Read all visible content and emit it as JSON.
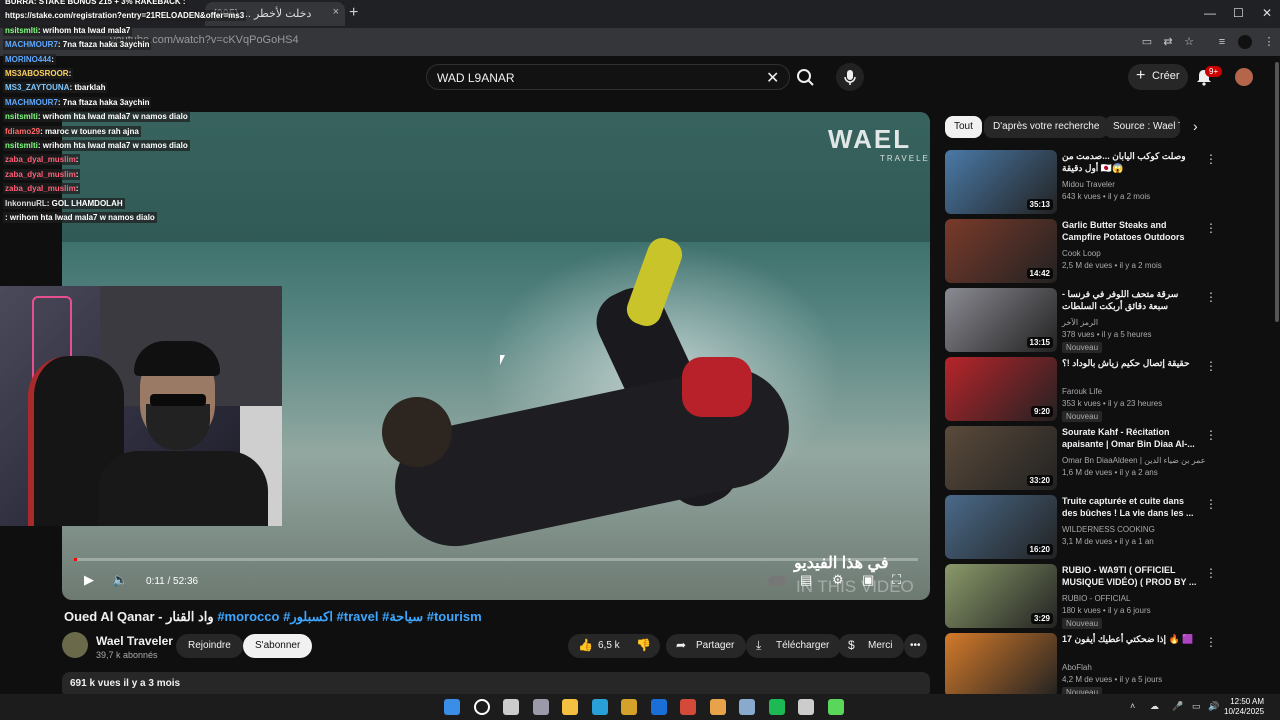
{
  "browser": {
    "tab_title": "دخلت لأخطر ... (295)",
    "tab_close": "×",
    "new_tab": "+",
    "url": "youtube.com/watch?v=cKVqPoGoHS4",
    "minimize": "—",
    "maximize": "☐",
    "close": "✕"
  },
  "youtube": {
    "search_value": "WAD L9ANAR",
    "create_label": "Créer",
    "notif_count": "9+"
  },
  "video": {
    "title_main": "Oued Al Qanar - واد القنار ",
    "title_tags": "#morocco #اكسبلور #travel #سياحة #tourism",
    "time": "0:11 / 52:36",
    "overlay_arabic": "في هذا الفيديو",
    "overlay_in_video": "IN THIS VIDEO",
    "watermark": "WAEL",
    "watermark_sub": "TRAVELER",
    "progress": 0.004
  },
  "channel": {
    "name": "Wael Traveler",
    "subs": "39,7 k abonnés",
    "join_label": "Rejoindre",
    "subscribe_label": "S'abonner"
  },
  "actions": {
    "likes": "6,5 k",
    "share": "Partager",
    "download": "Télécharger",
    "thanks": "Merci",
    "more": "•••"
  },
  "description": {
    "stats": "691 k vues  il y a 3 mois"
  },
  "chips": [
    "Tout",
    "D'après votre recherche",
    "Source : Wael T"
  ],
  "recommendations": [
    {
      "title": "وصلت كوكب اليابان ...صدمت من أول دقيقة 🇯🇵😱",
      "channel": "Midou Traveler",
      "meta": "643 k vues • il y a 2 mois",
      "duration": "35:13",
      "new": "",
      "color": "#4a7aa8"
    },
    {
      "title": "Garlic Butter Steaks and Campfire Potatoes Outdoors",
      "channel": "Cook Loop",
      "meta": "2,5 M de vues • il y a 2 mois",
      "duration": "14:42",
      "new": "",
      "color": "#7a3a2a"
    },
    {
      "title": "سرقة متحف اللوفر في فرنسا - سبعة دقائق أربكت السلطات الفرنسية",
      "channel": "الرمز الآخر",
      "meta": "378 vues • il y a 5 heures",
      "duration": "13:15",
      "new": "Nouveau",
      "color": "#8a8a92"
    },
    {
      "title": "حقيقة إتصال حكيم زياش بالوداد !؟",
      "channel": "Farouk Life",
      "meta": "353 k vues • il y a 23 heures",
      "duration": "9:20",
      "new": "Nouveau",
      "color": "#b8242a"
    },
    {
      "title": "Sourate Kahf - Récitation apaisante | Omar Bin Diaa Al-...",
      "channel": "Omar Bn DiaaAldeen | عمر بن ضياء الدين",
      "meta": "1,6 M de vues • il y a 2 ans",
      "duration": "33:20",
      "new": "",
      "color": "#5a4a3a"
    },
    {
      "title": "Truite capturée et cuite dans des bûches ! La vie dans les ...",
      "channel": "WILDERNESS COOKING",
      "meta": "3,1 M de vues • il y a 1 an",
      "duration": "16:20",
      "new": "",
      "color": "#4a6a8a"
    },
    {
      "title": "RUBIO - WA9TI ( OFFICIEL MUSIQUE VIDÉO) ( PROD BY ...",
      "channel": "RUBIO - OFFICIAL",
      "meta": "180 k vues • il y a 6 jours",
      "duration": "3:29",
      "new": "Nouveau",
      "color": "#8a9a6a"
    },
    {
      "title": "إذا ضحكتي أعطيك أيفون 17 🔥 🟪",
      "channel": "AboFlah",
      "meta": "4,2 M de vues • il y a 5 jours",
      "duration": "",
      "new": "Nouveau",
      "color": "#d47a2a"
    }
  ],
  "chat": [
    {
      "user": "BURRA",
      "msg": ": STAKE BONUS 215 + 3% RAKEBACK :",
      "ucolor": "#ffffff"
    },
    {
      "user": "https://stake.com/registration?entry=21RELOADEN&offer=ms3",
      "msg": "",
      "ucolor": "#ffffff"
    },
    {
      "user": "nsitsmlti",
      "msg": ": wrihom hta lwad mala7",
      "ucolor": "#7fff7f"
    },
    {
      "user": "MACHMOUR7",
      "msg": ": 7na ftaza haka 3aychin",
      "ucolor": "#5fa8ff"
    },
    {
      "user": "MORINO444",
      "msg": ":",
      "ucolor": "#5fa8ff"
    },
    {
      "user": "MS3ABOSROOR",
      "msg": ":",
      "ucolor": "#ffd35f"
    },
    {
      "user": "MS3_ZAYTOUNA",
      "msg": ": tbarklah",
      "ucolor": "#7fc7ff"
    },
    {
      "user": "MACHMOUR7",
      "msg": ": 7na ftaza haka 3aychin",
      "ucolor": "#5fa8ff"
    },
    {
      "user": "nsitsmlti",
      "msg": ": wrihom hta lwad mala7  w namos dialo",
      "ucolor": "#7fff7f"
    },
    {
      "user": "fdiamo29",
      "msg": ": maroc w tounes rah ajna",
      "ucolor": "#ff6a6a"
    },
    {
      "user": "nsitsmlti",
      "msg": ": wrihom hta lwad mala7  w namos dialo",
      "ucolor": "#7fff7f"
    },
    {
      "user": "zaba_dyal_muslim",
      "msg": ":",
      "ucolor": "#ff5f7a"
    },
    {
      "user": "zaba_dyal_muslim",
      "msg": ":",
      "ucolor": "#ff5f7a"
    },
    {
      "user": "zaba_dyal_muslim",
      "msg": ":",
      "ucolor": "#ff5f7a"
    },
    {
      "user": "InkonnuRL",
      "msg": ": GOL LHAMDOLAH",
      "ucolor": "#dddddd"
    },
    {
      "user": "",
      "msg": ": wrihom hta lwad mala7  w namos dialo",
      "ucolor": "#ffffff"
    }
  ],
  "taskbar": {
    "time": "12:50 AM",
    "date": "10/24/2025",
    "icon_colors": [
      "#3a8ee6",
      "#ffffff",
      "#cccccc",
      "#9a9aa8",
      "#f5c042",
      "#2aa0d8",
      "#d4a22a",
      "#1a6fd6",
      "#d34a3a",
      "#e8a34a",
      "#88aacc",
      "#1db954",
      "#cccccc",
      "#5ad65a"
    ]
  }
}
